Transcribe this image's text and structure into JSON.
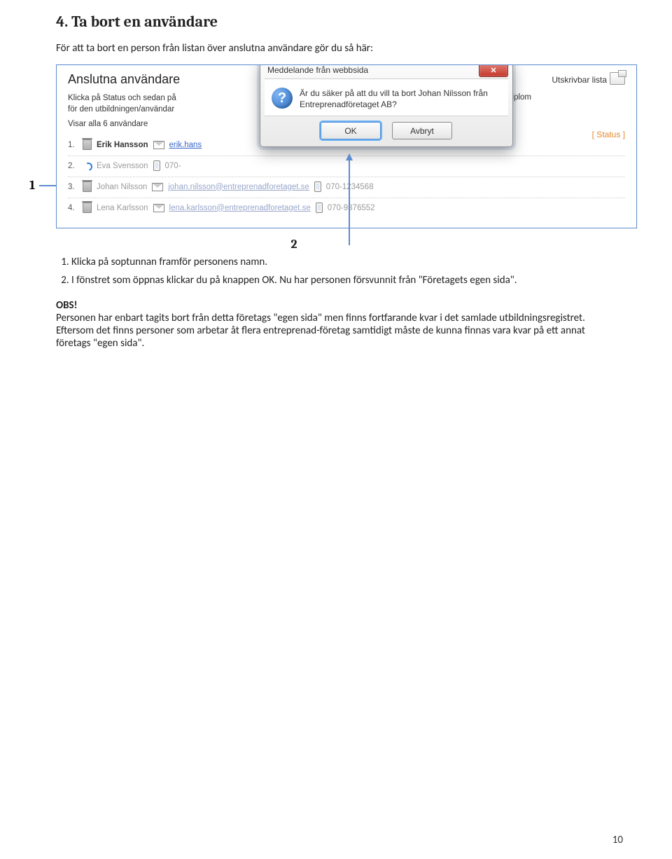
{
  "heading": "4. Ta bort en användare",
  "intro": "För att ta bort en person från listan över anslutna användare gör du så här:",
  "screenshot": {
    "panel_title": "Anslutna användare",
    "help_text": "Klicka på Status och sedan på\nför den utbildningen/användar",
    "help_tail": "att hämta/skriva ut diplom",
    "showing": "Visar alla 6 användare",
    "print_link": "Utskrivbar lista",
    "status_link": "[ Status ]",
    "users": [
      {
        "n": "1.",
        "name": "Erik Hansson",
        "email": "erik.hans",
        "phone": "",
        "faded": false,
        "extra": "mail"
      },
      {
        "n": "2.",
        "name": "Eva Svensson",
        "email": "",
        "phone": "070-",
        "faded": true,
        "extra": "arrow"
      },
      {
        "n": "3.",
        "name": "Johan Nilsson",
        "email": "johan.nilsson@entreprenadforetaget.se",
        "phone": "070-1234568",
        "faded": true,
        "extra": "trash"
      },
      {
        "n": "4.",
        "name": "Lena Karlsson",
        "email": "lena.karlsson@entreprenadforetaget.se",
        "phone": "070-9876552",
        "faded": true,
        "extra": "trash"
      }
    ]
  },
  "dialog": {
    "title": "Meddelande från webbsida",
    "message": "Är du säker på att du vill ta bort Johan Nilsson från Entreprenadföretaget AB?",
    "ok": "OK",
    "cancel": "Avbryt"
  },
  "callouts": {
    "one": "1",
    "two": "2"
  },
  "steps": {
    "s1": "Klicka på soptunnan framför personens namn.",
    "s2": "I fönstret som öppnas klickar du på knappen OK. Nu har personen försvunnit från \"Företagets egen sida\"."
  },
  "obs_label": "OBS!",
  "obs_p1": "Personen har enbart tagits bort från detta företags \"egen sida\" men finns fortfarande kvar i det samlade utbildningsregistret. Eftersom det finns personer som arbetar åt flera entreprenad-företag samtidigt måste de kunna finnas vara kvar på ett annat företags \"egen sida\".",
  "page_number": "10"
}
